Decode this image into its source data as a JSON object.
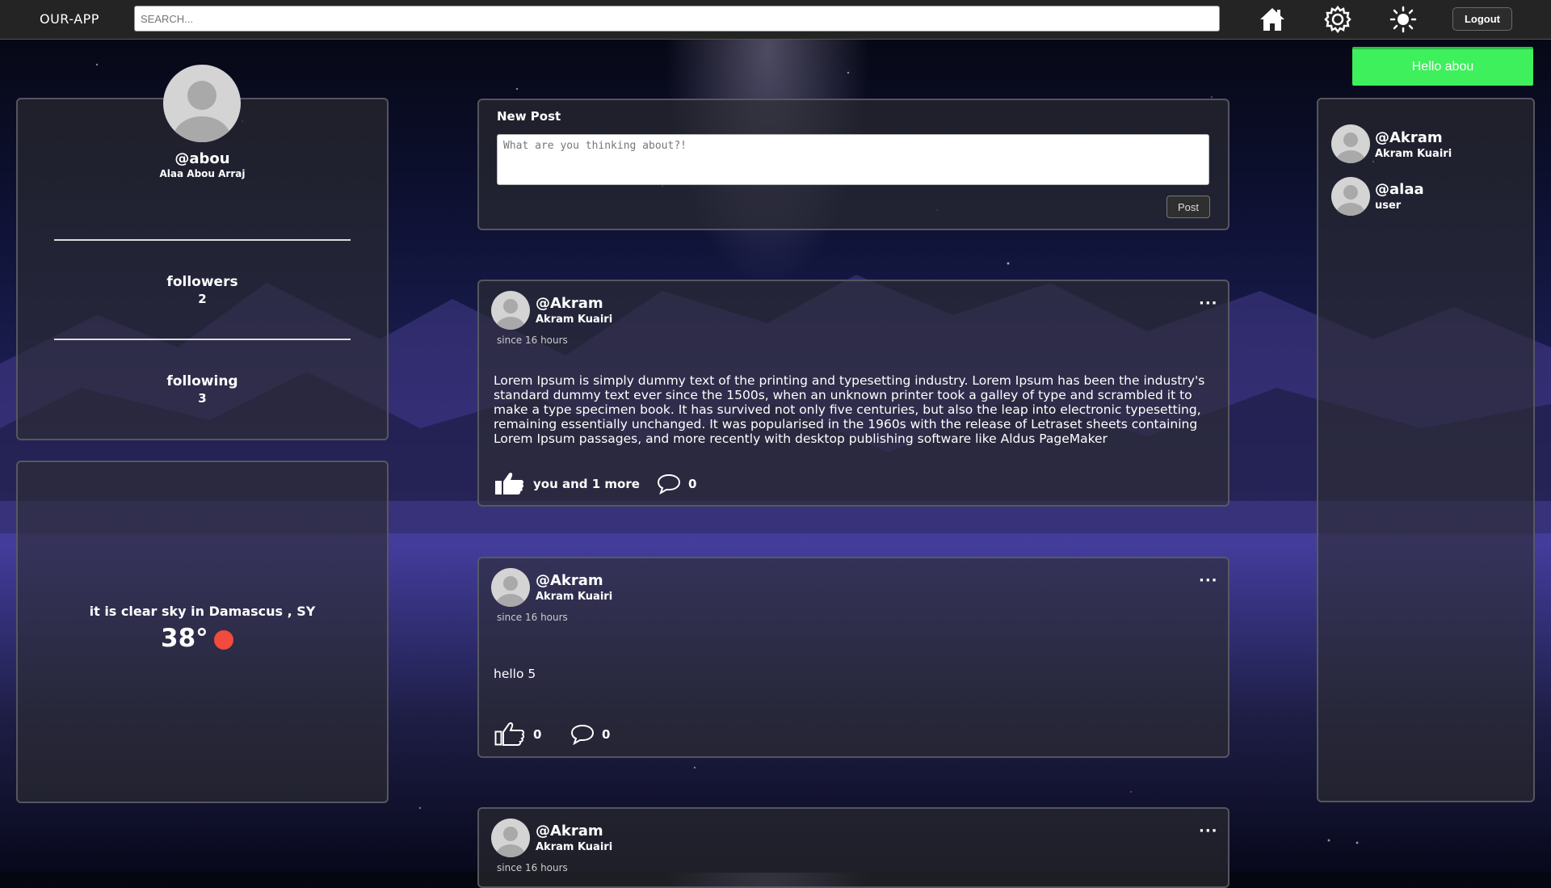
{
  "app": {
    "brand": "OUR-APP"
  },
  "search": {
    "placeholder": "SEARCH..."
  },
  "nav": {
    "home_icon": "home-icon",
    "settings_icon": "gear-icon",
    "theme_icon": "sun-icon",
    "logout_label": "Logout"
  },
  "greeting": "Hello abou",
  "profile": {
    "username": "@abou",
    "full_name": "Alaa Abou Arraj",
    "followers_label": "followers",
    "followers_count": "2",
    "following_label": "following",
    "following_count": "3"
  },
  "weather": {
    "text": "it is clear sky in Damascus , SY",
    "temperature": "38°",
    "indicator_color": "#f24a3c"
  },
  "new_post": {
    "title": "New Post",
    "placeholder": "What are you thinking about?!",
    "button_label": "Post"
  },
  "posts": [
    {
      "username": "@Akram",
      "full_name": "Akram Kuairi",
      "time": "since 16 hours",
      "more": "···",
      "body": "Lorem Ipsum is simply dummy text of the printing and typesetting industry. Lorem Ipsum has been the industry's standard dummy text ever since the 1500s, when an unknown printer took a galley of type and scrambled it to make a type specimen book. It has survived not only five centuries, but also the leap into electronic typesetting, remaining essentially unchanged. It was popularised in the 1960s with the release of Letraset sheets containing Lorem Ipsum passages, and more recently with desktop publishing software like Aldus PageMaker",
      "likes": "you and 1 more",
      "comments": "0"
    },
    {
      "username": "@Akram",
      "full_name": "Akram Kuairi",
      "time": "since 16 hours",
      "more": "···",
      "body": "hello 5",
      "likes": "0",
      "comments": "0"
    },
    {
      "username": "@Akram",
      "full_name": "Akram Kuairi",
      "time": "since 16 hours",
      "more": "···"
    }
  ],
  "users": [
    {
      "username": "@Akram",
      "subtitle": "Akram Kuairi"
    },
    {
      "username": "@alaa",
      "subtitle": "user"
    }
  ],
  "colors": {
    "greeting_bg": "#3ef05b",
    "topbar_bg": "#242424"
  }
}
